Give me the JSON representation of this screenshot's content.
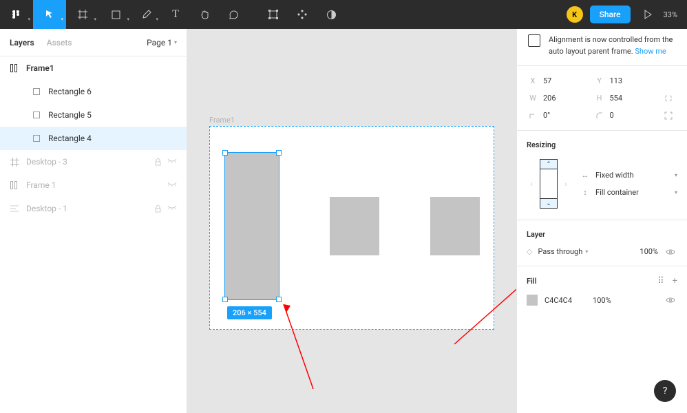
{
  "toolbar": {
    "avatar_initial": "K",
    "share_label": "Share",
    "zoom": "33%"
  },
  "left": {
    "tabs": {
      "layers": "Layers",
      "assets": "Assets"
    },
    "page_selector": "Page 1",
    "layers": [
      {
        "name": "Frame1"
      },
      {
        "name": "Rectangle 6"
      },
      {
        "name": "Rectangle 5"
      },
      {
        "name": "Rectangle 4"
      },
      {
        "name": "Desktop - 3"
      },
      {
        "name": "Frame 1"
      },
      {
        "name": "Desktop - 1"
      }
    ]
  },
  "canvas": {
    "frame_label": "Frame1",
    "selection_dims": "206 × 554"
  },
  "right": {
    "info_text": "Alignment is now controlled from the auto layout parent frame. ",
    "info_link": "Show me",
    "props": {
      "x_label": "X",
      "x": "57",
      "y_label": "Y",
      "y": "113",
      "w_label": "W",
      "w": "206",
      "h_label": "H",
      "h": "554",
      "rot": "0°",
      "rad": "0"
    },
    "resizing": {
      "title": "Resizing",
      "opt1": "Fixed width",
      "opt2": "Fill container"
    },
    "layer": {
      "title": "Layer",
      "blend": "Pass through",
      "opacity": "100%"
    },
    "fill": {
      "title": "Fill",
      "hex": "C4C4C4",
      "opacity": "100%"
    }
  },
  "help": "?"
}
